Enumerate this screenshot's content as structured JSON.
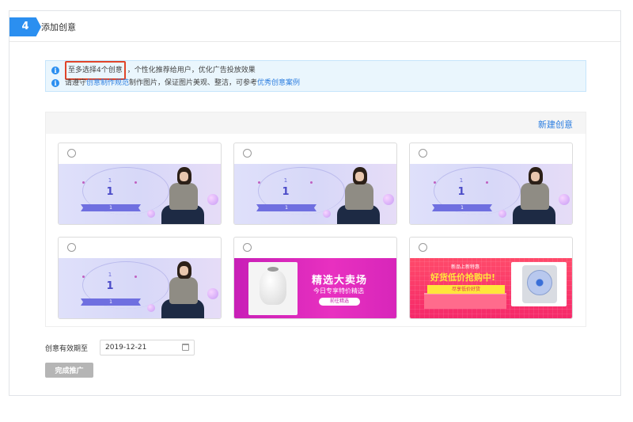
{
  "step": {
    "number": "4",
    "title": "添加创意"
  },
  "notice": {
    "line1_highlight": "至多选择4个创意",
    "line1_rest": "，个性化推荐给用户，优化广告投放效果",
    "line2_prefix": "请遵守",
    "line2_link1": "创意制作规范",
    "line2_middle": "制作图片，保证图片美观、整洁，可参考",
    "line2_link2": "优秀创意案例"
  },
  "gallery": {
    "new_button": "新建创意",
    "purple_banner": {
      "small": "1",
      "big": "1",
      "ribbon": "1"
    },
    "pink_banner": {
      "headline": "精选大卖场",
      "subline": "今日专享特价精选",
      "button": "前往精选"
    },
    "red_banner": {
      "tag": "新品上新特惠",
      "headline": "好货低价抢购中!",
      "strip": "尽享低价好货"
    }
  },
  "date": {
    "label": "创意有效期至",
    "value": "2019-12-21"
  },
  "submit": {
    "label": "完成推广"
  },
  "colors": {
    "accent": "#2b8ff0",
    "highlight_border": "#e0452a",
    "link": "#2b7de0"
  }
}
